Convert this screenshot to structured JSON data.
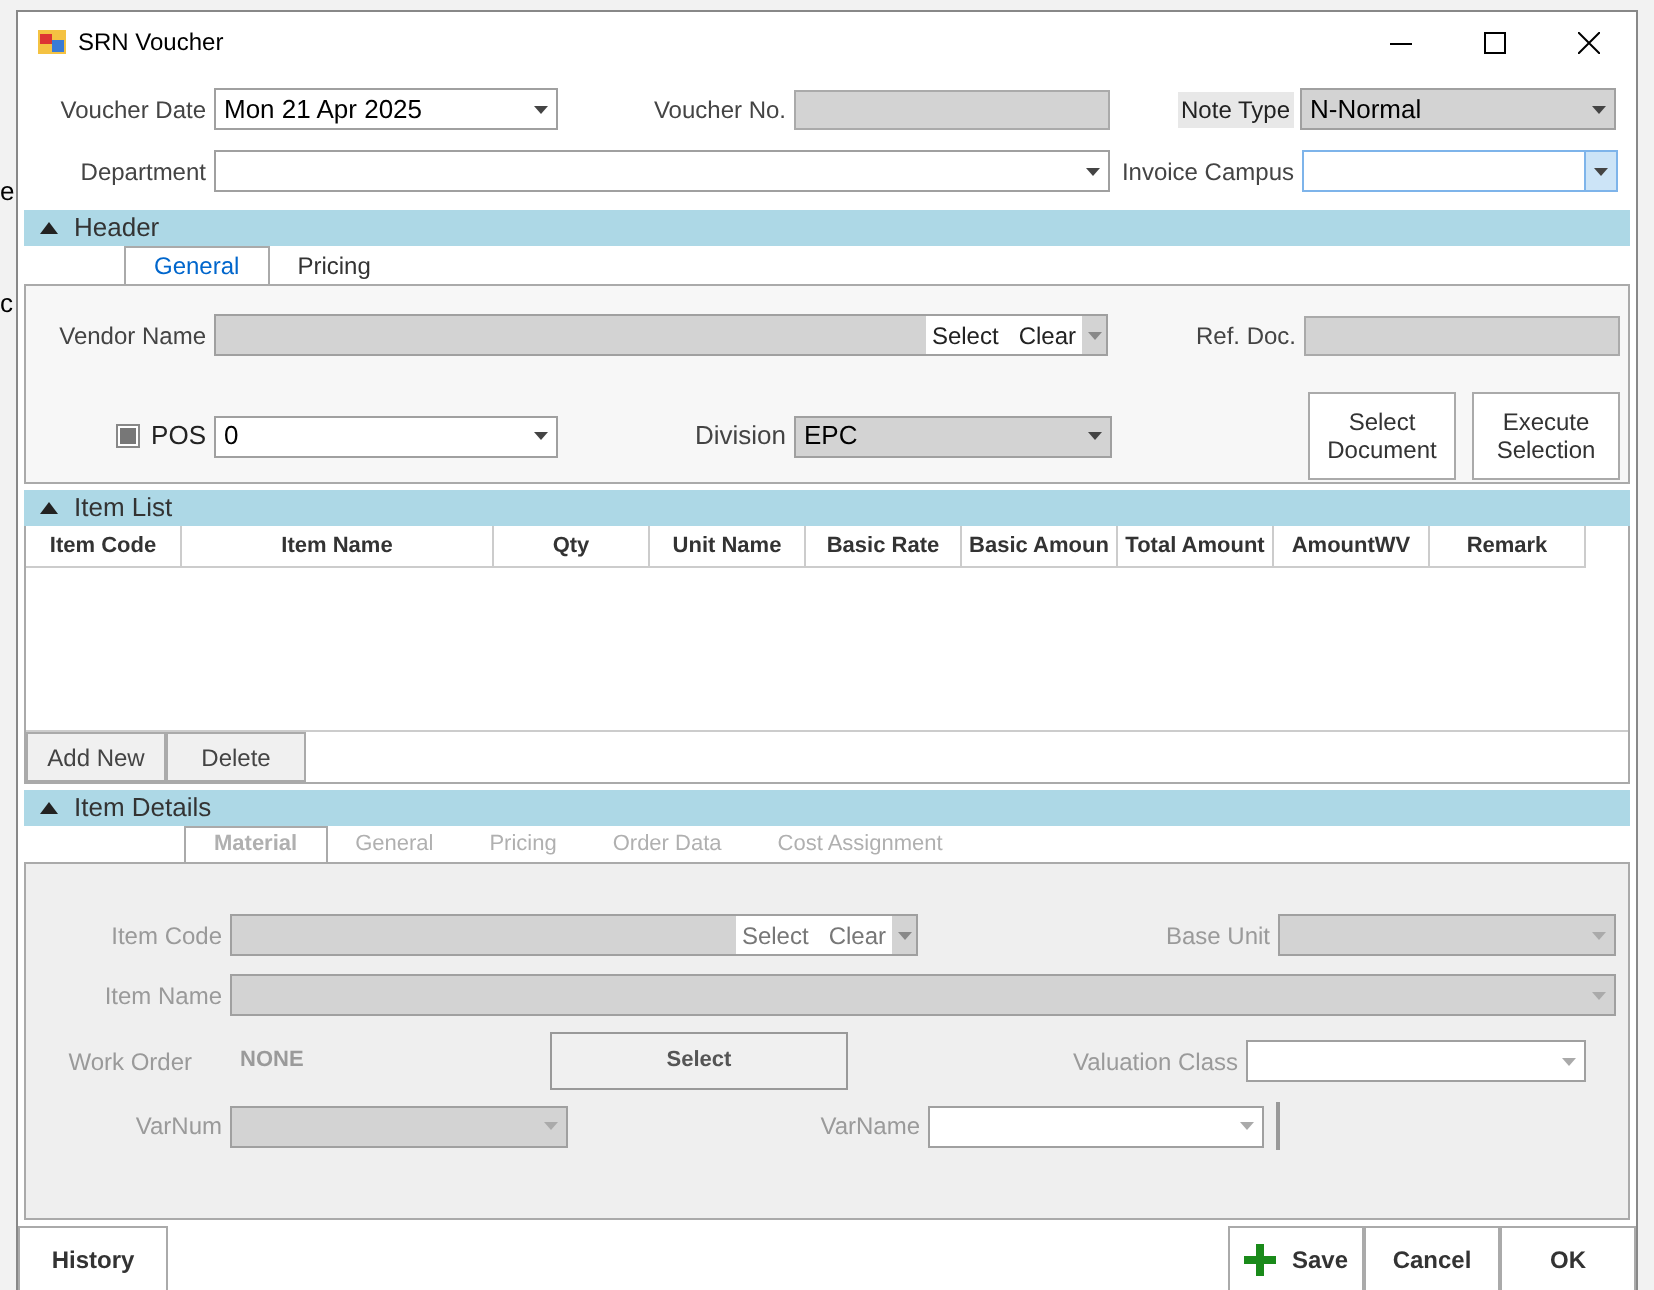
{
  "window": {
    "title": "SRN Voucher"
  },
  "background_fragments": [
    {
      "text": "e"
    },
    {
      "text": "c"
    }
  ],
  "voucher_date": {
    "label": "Voucher Date",
    "value": "Mon 21 Apr 2025"
  },
  "voucher_no": {
    "label": "Voucher No."
  },
  "note_type": {
    "label": "Note Type",
    "value": "N-Normal"
  },
  "department": {
    "label": "Department"
  },
  "invoice_campus": {
    "label": "Invoice Campus"
  },
  "header": {
    "title": "Header",
    "expanded": true,
    "tabs": [
      {
        "label": "General",
        "selected": true
      },
      {
        "label": "Pricing",
        "selected": false
      }
    ],
    "vendor": {
      "label": "Vendor Name",
      "select": "Select",
      "clear": "Clear"
    },
    "ref_doc": {
      "label": "Ref. Doc."
    },
    "pos": {
      "label": "POS",
      "checked": true,
      "value": "0"
    },
    "division": {
      "label": "Division",
      "value": "EPC"
    },
    "buttons": [
      "Select Document",
      "Execute Selection"
    ]
  },
  "item_list": {
    "title": "Item List",
    "expanded": true,
    "columns": [
      "Item Code",
      "Item Name",
      "Qty",
      "Unit Name",
      "Basic Rate",
      "Basic Amoun",
      "Total Amount",
      "AmountWV",
      "Remark"
    ],
    "buttons": [
      "Add New",
      "Delete"
    ]
  },
  "item_details": {
    "title": "Item Details",
    "expanded": true,
    "disabled": true,
    "tabs": [
      {
        "label": "Material",
        "selected": true
      },
      {
        "label": "General",
        "selected": false
      },
      {
        "label": "Pricing",
        "selected": false
      },
      {
        "label": "Order Data",
        "selected": false
      },
      {
        "label": "Cost Assignment",
        "selected": false
      }
    ],
    "item_code": {
      "label": "Item Code",
      "select": "Select",
      "clear": "Clear"
    },
    "base_unit": {
      "label": "Base Unit"
    },
    "item_name": {
      "label": "Item Name"
    },
    "work_order": {
      "label": "Work Order",
      "value": "NONE",
      "button": "Select"
    },
    "valuation_class": {
      "label": "Valuation Class"
    },
    "varnum": {
      "label": "VarNum"
    },
    "varname": {
      "label": "VarName"
    }
  },
  "footer": {
    "buttons": [
      {
        "label": "History",
        "kind": "plain"
      },
      {
        "label": "Save",
        "kind": "save"
      },
      {
        "label": "Cancel",
        "kind": "plain"
      },
      {
        "label": "OK",
        "kind": "plain"
      }
    ]
  }
}
